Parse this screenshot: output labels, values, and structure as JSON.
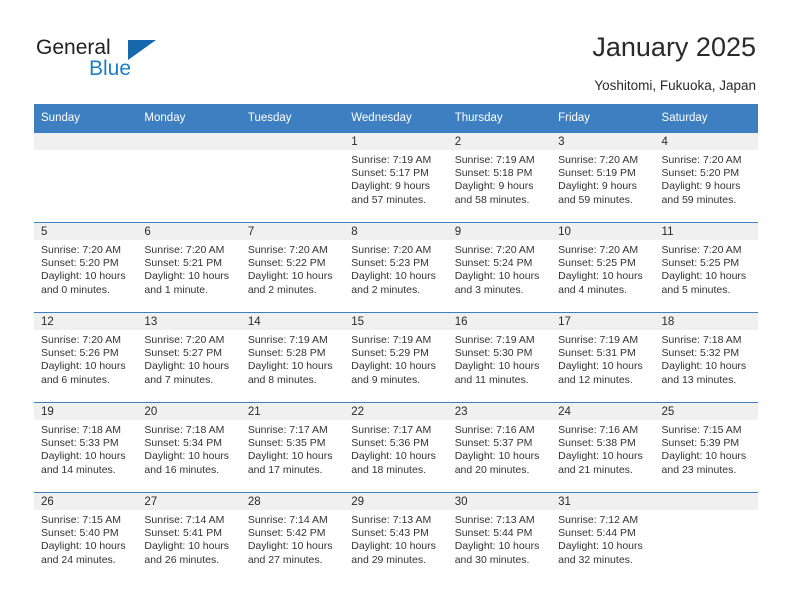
{
  "brand": {
    "word_general": "General",
    "word_blue": "Blue"
  },
  "header": {
    "title": "January 2025",
    "location": "Yoshitomi, Fukuoka, Japan"
  },
  "theme": {
    "header_blue": "#3d7fc1",
    "brand_blue": "#1b7fc4",
    "band_gray": "#f0f0f0",
    "text": "#2a2a2a"
  },
  "weekday_headers": [
    "Sunday",
    "Monday",
    "Tuesday",
    "Wednesday",
    "Thursday",
    "Friday",
    "Saturday"
  ],
  "weeks": [
    [
      {
        "day": "",
        "lines": []
      },
      {
        "day": "",
        "lines": []
      },
      {
        "day": "",
        "lines": []
      },
      {
        "day": "1",
        "lines": [
          "Sunrise: 7:19 AM",
          "Sunset: 5:17 PM",
          "Daylight: 9 hours",
          "and 57 minutes."
        ]
      },
      {
        "day": "2",
        "lines": [
          "Sunrise: 7:19 AM",
          "Sunset: 5:18 PM",
          "Daylight: 9 hours",
          "and 58 minutes."
        ]
      },
      {
        "day": "3",
        "lines": [
          "Sunrise: 7:20 AM",
          "Sunset: 5:19 PM",
          "Daylight: 9 hours",
          "and 59 minutes."
        ]
      },
      {
        "day": "4",
        "lines": [
          "Sunrise: 7:20 AM",
          "Sunset: 5:20 PM",
          "Daylight: 9 hours",
          "and 59 minutes."
        ]
      }
    ],
    [
      {
        "day": "5",
        "lines": [
          "Sunrise: 7:20 AM",
          "Sunset: 5:20 PM",
          "Daylight: 10 hours",
          "and 0 minutes."
        ]
      },
      {
        "day": "6",
        "lines": [
          "Sunrise: 7:20 AM",
          "Sunset: 5:21 PM",
          "Daylight: 10 hours",
          "and 1 minute."
        ]
      },
      {
        "day": "7",
        "lines": [
          "Sunrise: 7:20 AM",
          "Sunset: 5:22 PM",
          "Daylight: 10 hours",
          "and 2 minutes."
        ]
      },
      {
        "day": "8",
        "lines": [
          "Sunrise: 7:20 AM",
          "Sunset: 5:23 PM",
          "Daylight: 10 hours",
          "and 2 minutes."
        ]
      },
      {
        "day": "9",
        "lines": [
          "Sunrise: 7:20 AM",
          "Sunset: 5:24 PM",
          "Daylight: 10 hours",
          "and 3 minutes."
        ]
      },
      {
        "day": "10",
        "lines": [
          "Sunrise: 7:20 AM",
          "Sunset: 5:25 PM",
          "Daylight: 10 hours",
          "and 4 minutes."
        ]
      },
      {
        "day": "11",
        "lines": [
          "Sunrise: 7:20 AM",
          "Sunset: 5:25 PM",
          "Daylight: 10 hours",
          "and 5 minutes."
        ]
      }
    ],
    [
      {
        "day": "12",
        "lines": [
          "Sunrise: 7:20 AM",
          "Sunset: 5:26 PM",
          "Daylight: 10 hours",
          "and 6 minutes."
        ]
      },
      {
        "day": "13",
        "lines": [
          "Sunrise: 7:20 AM",
          "Sunset: 5:27 PM",
          "Daylight: 10 hours",
          "and 7 minutes."
        ]
      },
      {
        "day": "14",
        "lines": [
          "Sunrise: 7:19 AM",
          "Sunset: 5:28 PM",
          "Daylight: 10 hours",
          "and 8 minutes."
        ]
      },
      {
        "day": "15",
        "lines": [
          "Sunrise: 7:19 AM",
          "Sunset: 5:29 PM",
          "Daylight: 10 hours",
          "and 9 minutes."
        ]
      },
      {
        "day": "16",
        "lines": [
          "Sunrise: 7:19 AM",
          "Sunset: 5:30 PM",
          "Daylight: 10 hours",
          "and 11 minutes."
        ]
      },
      {
        "day": "17",
        "lines": [
          "Sunrise: 7:19 AM",
          "Sunset: 5:31 PM",
          "Daylight: 10 hours",
          "and 12 minutes."
        ]
      },
      {
        "day": "18",
        "lines": [
          "Sunrise: 7:18 AM",
          "Sunset: 5:32 PM",
          "Daylight: 10 hours",
          "and 13 minutes."
        ]
      }
    ],
    [
      {
        "day": "19",
        "lines": [
          "Sunrise: 7:18 AM",
          "Sunset: 5:33 PM",
          "Daylight: 10 hours",
          "and 14 minutes."
        ]
      },
      {
        "day": "20",
        "lines": [
          "Sunrise: 7:18 AM",
          "Sunset: 5:34 PM",
          "Daylight: 10 hours",
          "and 16 minutes."
        ]
      },
      {
        "day": "21",
        "lines": [
          "Sunrise: 7:17 AM",
          "Sunset: 5:35 PM",
          "Daylight: 10 hours",
          "and 17 minutes."
        ]
      },
      {
        "day": "22",
        "lines": [
          "Sunrise: 7:17 AM",
          "Sunset: 5:36 PM",
          "Daylight: 10 hours",
          "and 18 minutes."
        ]
      },
      {
        "day": "23",
        "lines": [
          "Sunrise: 7:16 AM",
          "Sunset: 5:37 PM",
          "Daylight: 10 hours",
          "and 20 minutes."
        ]
      },
      {
        "day": "24",
        "lines": [
          "Sunrise: 7:16 AM",
          "Sunset: 5:38 PM",
          "Daylight: 10 hours",
          "and 21 minutes."
        ]
      },
      {
        "day": "25",
        "lines": [
          "Sunrise: 7:15 AM",
          "Sunset: 5:39 PM",
          "Daylight: 10 hours",
          "and 23 minutes."
        ]
      }
    ],
    [
      {
        "day": "26",
        "lines": [
          "Sunrise: 7:15 AM",
          "Sunset: 5:40 PM",
          "Daylight: 10 hours",
          "and 24 minutes."
        ]
      },
      {
        "day": "27",
        "lines": [
          "Sunrise: 7:14 AM",
          "Sunset: 5:41 PM",
          "Daylight: 10 hours",
          "and 26 minutes."
        ]
      },
      {
        "day": "28",
        "lines": [
          "Sunrise: 7:14 AM",
          "Sunset: 5:42 PM",
          "Daylight: 10 hours",
          "and 27 minutes."
        ]
      },
      {
        "day": "29",
        "lines": [
          "Sunrise: 7:13 AM",
          "Sunset: 5:43 PM",
          "Daylight: 10 hours",
          "and 29 minutes."
        ]
      },
      {
        "day": "30",
        "lines": [
          "Sunrise: 7:13 AM",
          "Sunset: 5:44 PM",
          "Daylight: 10 hours",
          "and 30 minutes."
        ]
      },
      {
        "day": "31",
        "lines": [
          "Sunrise: 7:12 AM",
          "Sunset: 5:44 PM",
          "Daylight: 10 hours",
          "and 32 minutes."
        ]
      },
      {
        "day": "",
        "lines": []
      }
    ]
  ]
}
